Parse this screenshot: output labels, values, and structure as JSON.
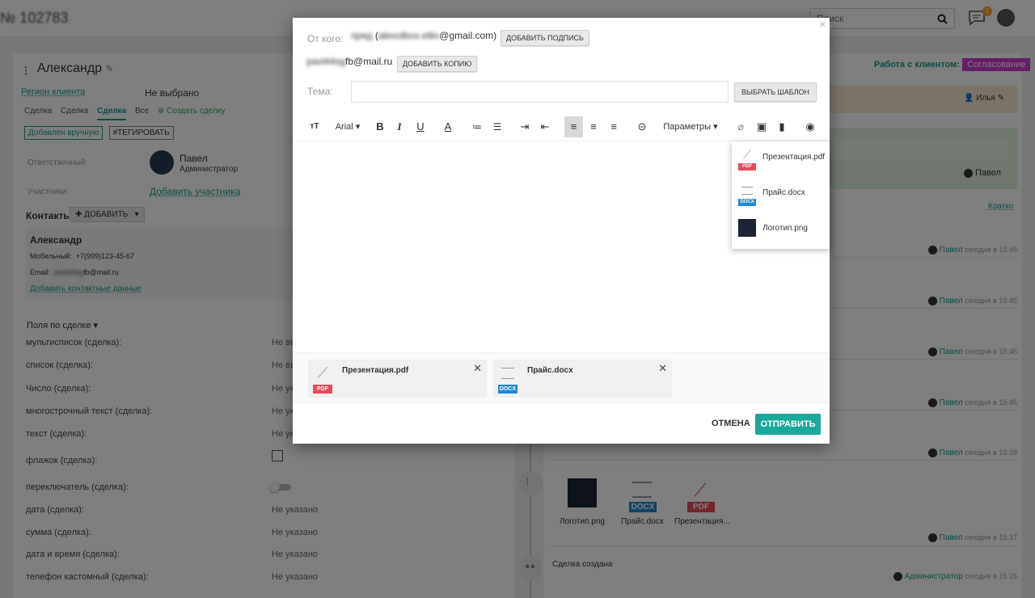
{
  "topbar": {
    "deal_id": "№ 102783",
    "search_placeholder": "Поиск",
    "chat_badge": "1"
  },
  "left": {
    "contact_name": "Александр",
    "region_label": "Регион клиента",
    "region_value": "Не выбрано",
    "tabs": [
      "Сделка",
      "Сделка",
      "Сделка",
      "Все"
    ],
    "create_deal": "Создать сделку",
    "chip_added": "Добавлен вручную",
    "chip_tag": "#ТЕГИРОВАТЬ",
    "responsible_label": "Ответственный:",
    "responsible_name": "Павел",
    "responsible_role": "Администратор",
    "participants_label": "Участники:",
    "add_participant": "Добавить участника",
    "contacts_title": "Контакты",
    "add_button": "ДОБАВИТЬ",
    "contact": {
      "name": "Александр",
      "mobile_label": "Мобильный:",
      "mobile": "+7(999)123-45-67",
      "email_label": "Email:",
      "email_blur": "pavl44sg",
      "email_domain": "fb@mail.ru",
      "add_contact_data": "Добавить контактные данные"
    },
    "fields_title": "Поля по сделке",
    "fields": [
      {
        "label": "мультисписок (сделка):",
        "value": "Не вы"
      },
      {
        "label": "список (сделка):",
        "value": "Не вы"
      },
      {
        "label": "Число (сделка):",
        "value": "Не ук"
      },
      {
        "label": "многострочный текст (сделка):",
        "value": "Не ук"
      },
      {
        "label": "текст (сделка):",
        "value": "Не ук"
      },
      {
        "label": "флажок (сделка):",
        "value": ""
      },
      {
        "label": "переключатель (сделка):",
        "value": ""
      },
      {
        "label": "дата (сделка):",
        "value": "Не указано"
      },
      {
        "label": "сумма (сделка):",
        "value": "Не указано"
      },
      {
        "label": "дата и время (сделка):",
        "value": "Не указано"
      },
      {
        "label": "телефон кастомный (сделка):",
        "value": "Не указано"
      }
    ]
  },
  "right": {
    "work_label": "Работа с клиентом:",
    "work_status": "Согласование",
    "owner": "Илья",
    "green_user": "Павел",
    "brief": "Кратко",
    "feed": [
      {
        "who": "Павел",
        "when": "сегодня в 15:45"
      },
      {
        "who": "Павел",
        "when": "сегодня в 15:45"
      },
      {
        "who": "Павел",
        "when": "сегодня в 15:45"
      },
      {
        "who": "Павел",
        "when": "сегодня в 15:45"
      },
      {
        "who": "Павел",
        "when": "сегодня в 15:38"
      },
      {
        "who": "Павел",
        "when": "сегодня в 15:37"
      }
    ],
    "attachments": [
      "Логотип.png",
      "Прайс.docx",
      "Презентация..."
    ],
    "deal_created": "Сделка создана",
    "admin": "Администратор",
    "admin_when": "сегодня в 15:26"
  },
  "modal": {
    "from_label": "От кого:",
    "from_blur_name": "пряд",
    "from_blur_user": "alexolbox.ellio",
    "from_domain": "@gmail.com)",
    "add_signature": "ДОБАВИТЬ ПОДПИСЬ",
    "cc_blur": "pavl44sg",
    "cc_domain": "fb@mail.ru",
    "add_copy": "ДОБАВИТЬ КОПИЮ",
    "subject_label": "Тема:",
    "subject_value": "",
    "choose_template": "ВЫБРАТЬ ШАБЛОН",
    "font": "Arial",
    "params": "Параметры",
    "dropdown": [
      {
        "name": "Презентация.pdf",
        "type": "PDF"
      },
      {
        "name": "Прайс.docx",
        "type": "DOCX"
      },
      {
        "name": "Логотип.png",
        "type": "image"
      }
    ],
    "attached": [
      {
        "name": "Презентация.pdf",
        "type": "PDF"
      },
      {
        "name": "Прайс.docx",
        "type": "DOCX"
      }
    ],
    "cancel": "ОТМЕНА",
    "send": "ОТПРАВИТЬ"
  },
  "colors": {
    "accent": "#1aa89a",
    "pink": "#c83cc8",
    "pdf": "#e84b5a",
    "docx": "#1d89d1"
  }
}
